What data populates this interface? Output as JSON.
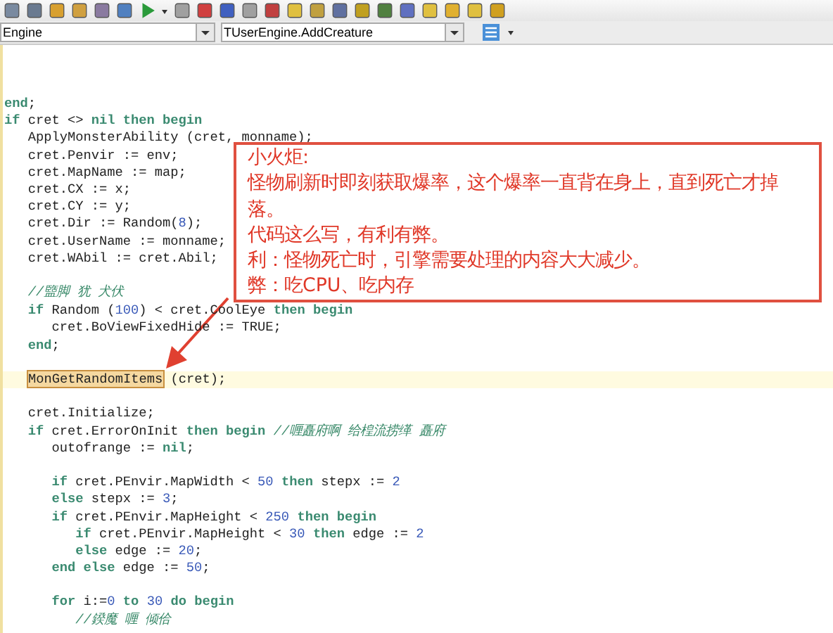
{
  "toolbar": {
    "unit_combo": "Engine",
    "method_combo": "TUserEngine.AddCreature"
  },
  "editor": {
    "lines": [
      {
        "current": false,
        "tokens": [
          {
            "kind": "kw",
            "t": "end"
          },
          {
            "kind": "plain",
            "t": ";"
          }
        ]
      },
      {
        "current": false,
        "tokens": [
          {
            "kind": "kw",
            "t": "if"
          },
          {
            "kind": "plain",
            "t": " cret <> "
          },
          {
            "kind": "kw",
            "t": "nil then begin"
          }
        ]
      },
      {
        "current": false,
        "tokens": [
          {
            "kind": "plain",
            "t": "   ApplyMonsterAbility (cret, monname);"
          }
        ]
      },
      {
        "current": false,
        "tokens": [
          {
            "kind": "plain",
            "t": "   cret.Penvir := env;"
          }
        ]
      },
      {
        "current": false,
        "tokens": [
          {
            "kind": "plain",
            "t": "   cret.MapName := map;"
          }
        ]
      },
      {
        "current": false,
        "tokens": [
          {
            "kind": "plain",
            "t": "   cret.CX := x;"
          }
        ]
      },
      {
        "current": false,
        "tokens": [
          {
            "kind": "plain",
            "t": "   cret.CY := y;"
          }
        ]
      },
      {
        "current": false,
        "tokens": [
          {
            "kind": "plain",
            "t": "   cret.Dir := Random("
          },
          {
            "kind": "num",
            "t": "8"
          },
          {
            "kind": "plain",
            "t": ");"
          }
        ]
      },
      {
        "current": false,
        "tokens": [
          {
            "kind": "plain",
            "t": "   cret.UserName := monname;"
          }
        ]
      },
      {
        "current": false,
        "tokens": [
          {
            "kind": "plain",
            "t": "   cret.WAbil := cret.Abil;"
          }
        ]
      },
      {
        "current": false
      },
      {
        "current": false,
        "tokens": [
          {
            "kind": "comment",
            "t": "   //盬脚 犹 犬伏"
          }
        ]
      },
      {
        "current": false,
        "tokens": [
          {
            "kind": "kw",
            "t": "   if"
          },
          {
            "kind": "plain",
            "t": " Random ("
          },
          {
            "kind": "num",
            "t": "100"
          },
          {
            "kind": "plain",
            "t": ") < cret.CoolEye "
          },
          {
            "kind": "kw",
            "t": "then begin"
          }
        ]
      },
      {
        "current": false,
        "tokens": [
          {
            "kind": "plain",
            "t": "      cret.BoViewFixedHide := TRUE;"
          }
        ]
      },
      {
        "current": false,
        "tokens": [
          {
            "kind": "kw",
            "t": "   end"
          },
          {
            "kind": "plain",
            "t": ";"
          }
        ]
      },
      {
        "current": false
      },
      {
        "current": true,
        "tokens": [
          {
            "kind": "match",
            "t": "MonGetRandomItems"
          },
          {
            "kind": "plain",
            "t": " (cret);"
          }
        ]
      },
      {
        "current": false
      },
      {
        "current": false,
        "tokens": [
          {
            "kind": "plain",
            "t": "   cret.Initialize;"
          }
        ]
      },
      {
        "current": false,
        "tokens": [
          {
            "kind": "kw",
            "t": "   if"
          },
          {
            "kind": "plain",
            "t": " cret.ErrorOnInit "
          },
          {
            "kind": "kw",
            "t": "then begin "
          },
          {
            "kind": "comment",
            "t": "//喱矗府啊 给楻流捞缂 矗府"
          }
        ]
      },
      {
        "current": false,
        "tokens": [
          {
            "kind": "plain",
            "t": "      outofrange := "
          },
          {
            "kind": "kw",
            "t": "nil"
          },
          {
            "kind": "plain",
            "t": ";"
          }
        ]
      },
      {
        "current": false
      },
      {
        "current": false,
        "tokens": [
          {
            "kind": "kw",
            "t": "      if"
          },
          {
            "kind": "plain",
            "t": " cret.PEnvir.MapWidth < "
          },
          {
            "kind": "num",
            "t": "50"
          },
          {
            "kind": "kw",
            "t": " then"
          },
          {
            "kind": "plain",
            "t": " stepx := "
          },
          {
            "kind": "num",
            "t": "2"
          }
        ]
      },
      {
        "current": false,
        "tokens": [
          {
            "kind": "kw",
            "t": "      else"
          },
          {
            "kind": "plain",
            "t": " stepx := "
          },
          {
            "kind": "num",
            "t": "3"
          },
          {
            "kind": "plain",
            "t": ";"
          }
        ]
      },
      {
        "current": false,
        "tokens": [
          {
            "kind": "kw",
            "t": "      if"
          },
          {
            "kind": "plain",
            "t": " cret.PEnvir.MapHeight < "
          },
          {
            "kind": "num",
            "t": "250"
          },
          {
            "kind": "kw",
            "t": " then begin"
          }
        ]
      },
      {
        "current": false,
        "tokens": [
          {
            "kind": "kw",
            "t": "         if"
          },
          {
            "kind": "plain",
            "t": " cret.PEnvir.MapHeight < "
          },
          {
            "kind": "num",
            "t": "30"
          },
          {
            "kind": "kw",
            "t": " then"
          },
          {
            "kind": "plain",
            "t": " edge := "
          },
          {
            "kind": "num",
            "t": "2"
          }
        ]
      },
      {
        "current": false,
        "tokens": [
          {
            "kind": "kw",
            "t": "         else"
          },
          {
            "kind": "plain",
            "t": " edge := "
          },
          {
            "kind": "num",
            "t": "20"
          },
          {
            "kind": "plain",
            "t": ";"
          }
        ]
      },
      {
        "current": false,
        "tokens": [
          {
            "kind": "kw",
            "t": "      end else"
          },
          {
            "kind": "plain",
            "t": " edge := "
          },
          {
            "kind": "num",
            "t": "50"
          },
          {
            "kind": "plain",
            "t": ";"
          }
        ]
      },
      {
        "current": false
      },
      {
        "current": false,
        "tokens": [
          {
            "kind": "kw",
            "t": "      for"
          },
          {
            "kind": "plain",
            "t": " i:="
          },
          {
            "kind": "num",
            "t": "0"
          },
          {
            "kind": "kw",
            "t": " to"
          },
          {
            "kind": "num",
            "t": " 30"
          },
          {
            "kind": "kw",
            "t": " do begin"
          }
        ]
      },
      {
        "current": false,
        "tokens": [
          {
            "kind": "comment",
            "t": "         //鍨魔 喱 倾佮"
          }
        ]
      }
    ]
  },
  "callout": {
    "title": "小火炬:",
    "paragraphs": [
      "怪物刷新时即刻获取爆率，这个爆率一直背在身上，直到死亡才掉落。",
      "代码这么写，有利有弊。",
      "利：怪物死亡时，引擎需要处理的内容大大减少。",
      "弊：吃CPU、吃内存"
    ]
  }
}
